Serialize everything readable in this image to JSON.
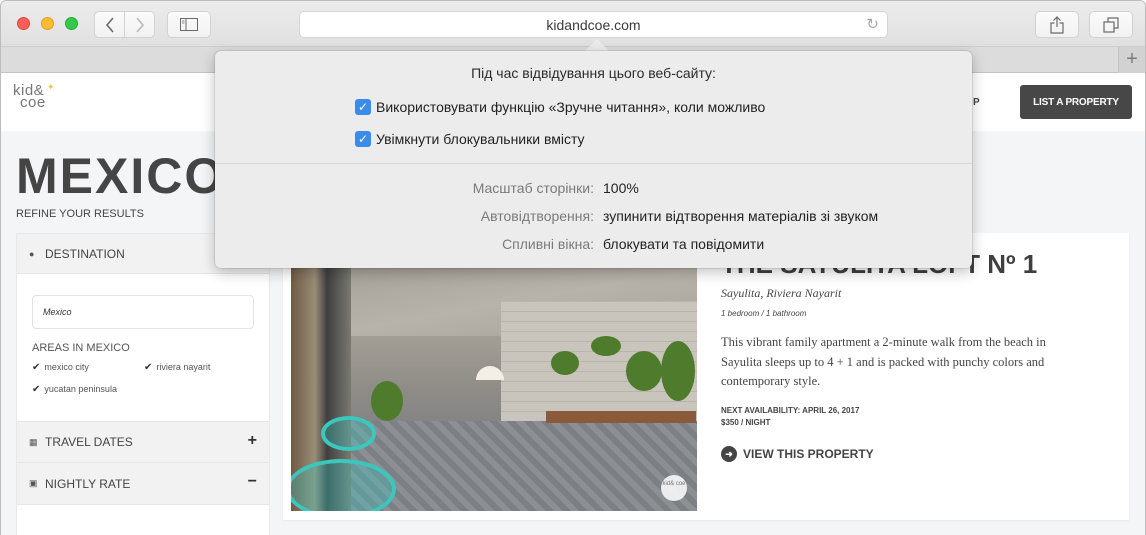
{
  "browser": {
    "url": "kidandcoe.com",
    "new_tab_label": "+"
  },
  "site": {
    "logo_line1": "kid&",
    "logo_line2": "coe",
    "nav_partial": "P",
    "list_property_label": "LIST A PROPERTY",
    "page_title": "MEXICO",
    "refine_label": "REFINE YOUR RESULTS"
  },
  "filters": {
    "destination": {
      "label": "DESTINATION",
      "input_value": "Mexico",
      "areas_title": "AREAS IN MEXICO",
      "areas": [
        {
          "label": "mexico city",
          "checked": true
        },
        {
          "label": "riviera nayarit",
          "checked": true
        },
        {
          "label": "yucatan peninsula",
          "checked": true
        }
      ]
    },
    "travel_dates": {
      "label": "TRAVEL DATES",
      "toggle": "+"
    },
    "nightly_rate": {
      "label": "NIGHTLY RATE",
      "toggle": "−"
    }
  },
  "property": {
    "title": "THE SAYULITA LOFT Nº 1",
    "location": "Sayulita, Riviera Nayarit",
    "rooms": "1 bedroom / 1 bathroom",
    "description": "This vibrant family apartment a 2-minute walk from the beach in Sayulita sleeps up to 4 + 1 and is packed with punchy colors and contemporary style.",
    "availability": "NEXT AVAILABILITY: APRIL 26, 2017",
    "price": "$350 / NIGHT",
    "view_label": "VIEW THIS PROPERTY",
    "photo_badge": "kid& coe"
  },
  "popover": {
    "title": "Під час відвідування цього веб-сайту:",
    "checkboxes": [
      {
        "label": "Використовувати функцію «Зручне читання», коли можливо",
        "checked": true
      },
      {
        "label": "Увімкнути блокувальники вмісту",
        "checked": true
      }
    ],
    "settings": [
      {
        "label": "Масштаб сторінки:",
        "value": "100%"
      },
      {
        "label": "Автовідтворення:",
        "value": "зупинити відтворення матеріалів зі звуком"
      },
      {
        "label": "Спливні вікна:",
        "value": "блокувати та повідомити"
      }
    ]
  }
}
